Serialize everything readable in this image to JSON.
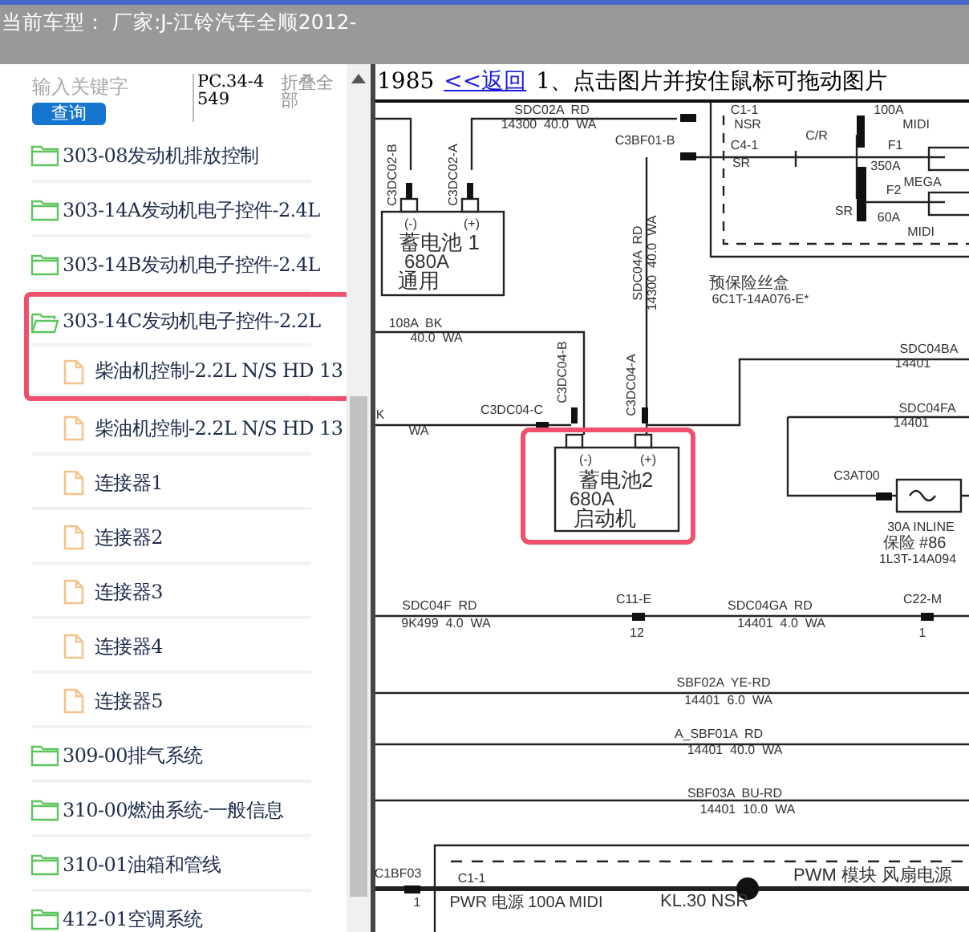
{
  "window": {
    "title": "当前车型： 厂家:J-江铃汽车全顺2012-"
  },
  "sidebar": {
    "search": {
      "placeholder": "输入关键字",
      "button": "查询"
    },
    "code": "PC.34-4549",
    "collapse_all": "折叠全部",
    "tree": [
      {
        "label": "303-08发动机排放控制",
        "expanded": false,
        "highlighted": false
      },
      {
        "label": "303-14A发动机电子控件-2.4L",
        "expanded": false,
        "highlighted": false
      },
      {
        "label": "303-14B发动机电子控件-2.4L",
        "expanded": false,
        "highlighted": false
      },
      {
        "label": "303-14C发动机电子控件-2.2L",
        "expanded": true,
        "highlighted": true,
        "children": [
          {
            "label": "柴油机控制-2.2L N/S HD 13",
            "highlighted": true
          },
          {
            "label": "柴油机控制-2.2L N/S HD 13",
            "highlighted": false
          },
          {
            "label": "连接器1",
            "highlighted": false
          },
          {
            "label": "连接器2",
            "highlighted": false
          },
          {
            "label": "连接器3",
            "highlighted": false
          },
          {
            "label": "连接器4",
            "highlighted": false
          },
          {
            "label": "连接器5",
            "highlighted": false
          }
        ]
      },
      {
        "label": "309-00排气系统",
        "expanded": false,
        "highlighted": false
      },
      {
        "label": "310-00燃油系统-一般信息",
        "expanded": false,
        "highlighted": false
      },
      {
        "label": "310-01油箱和管线",
        "expanded": false,
        "highlighted": false
      },
      {
        "label": "412-01空调系统",
        "expanded": false,
        "highlighted": false
      }
    ]
  },
  "viewer": {
    "year": "1985",
    "back_link": "<<返回",
    "instruction": "1、点击图片并按住鼠标可拖动图片",
    "diagram": {
      "highlight": true,
      "labels": [
        "SDC02A  RD",
        "14300  40.0  WA",
        "C3BF01-B",
        "C1-1",
        "NSR",
        "C/R",
        "C4-1",
        "SR",
        "100A",
        "MIDI",
        "F1",
        "350A",
        "MEGA",
        "SR",
        "F2",
        "60A",
        "MIDI",
        "C3DC02-B",
        "C3DC02-A",
        "(-)",
        "(+)",
        "蓄电池 1",
        "680A",
        "通用",
        "预保险丝盒",
        "6C1T-14A076-E*",
        "SDC04A  RD",
        "14300  40.0  WA",
        "108A  BK",
        "40.0  WA",
        "SDC04BA",
        "14401",
        "C3DC04-B",
        "C3DC04-A",
        "C3DC04-C",
        "K",
        "WA",
        "(-)",
        "(+)",
        "蓄电池2",
        "680A",
        "启动机",
        "SDC04FA",
        "14401",
        "C3AT00",
        "30A INLINE",
        "保险 #86",
        "1L3T-14A094",
        "SDC04F  RD",
        "9K499  4.0  WA",
        "C11-E",
        "12",
        "SDC04GA  RD",
        "14401  4.0  WA",
        "C22-M",
        "1",
        "SBF02A  YE-RD",
        "14401  6.0  WA",
        "A_SBF01A  RD",
        "14401  40.0  WA",
        "SBF03A  BU-RD",
        "14401  10.0  WA",
        "C1BF03",
        "1",
        "C1-1",
        "PWR 电源 100A MIDI",
        "KL.30 NSR",
        "PWM 模块 风扇电源"
      ]
    }
  }
}
